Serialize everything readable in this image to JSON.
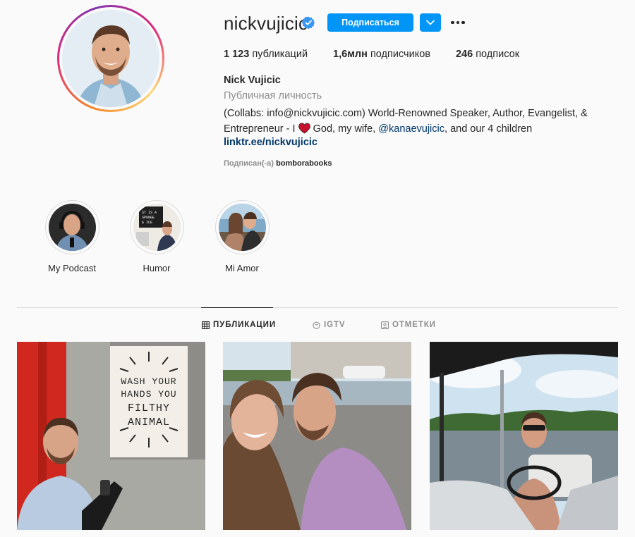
{
  "profile": {
    "username": "nickvujicic",
    "follow_label": "Подписаться",
    "stats": {
      "posts_count": "1 123",
      "posts_label": "публикаций",
      "followers_count": "1,6млн",
      "followers_label": "подписчиков",
      "following_count": "246",
      "following_label": "подписок"
    },
    "full_name": "Nick Vujicic",
    "category": "Публичная личность",
    "bio_line1": "(Collabs: info@nickvujicic.com) World-Renowned Speaker, Author, Evangelist, &",
    "bio_line2_start": "Entrepreneur - I",
    "bio_line2_mid": "God, my wife,",
    "bio_mention": "@kanaevujicic",
    "bio_line2_end": ", and our 4 children",
    "link": "linktr.ee/nickvujicic",
    "followed_by_prefix": "Подписан(-а)",
    "followed_by_user": "bomborabooks"
  },
  "highlights": [
    {
      "label": "My Podcast"
    },
    {
      "label": "Humor"
    },
    {
      "label": "Mi Amor"
    }
  ],
  "tabs": [
    {
      "label": "ПУБЛИКАЦИИ",
      "icon": "grid-icon",
      "active": true
    },
    {
      "label": "IGTV",
      "icon": "igtv-icon",
      "active": false
    },
    {
      "label": "ОТМЕТКИ",
      "icon": "tagged-icon",
      "active": false
    }
  ],
  "posts": [
    {
      "sign_lines": [
        "WASH YOUR",
        "HANDS YOU",
        "FILTHY",
        "ANIMAL"
      ]
    },
    {},
    {}
  ],
  "highlight_sign_lines": [
    "ST IS A",
    "SPONGE",
    "& ICE"
  ],
  "colors": {
    "accent": "#0095f6",
    "link": "#00376b",
    "muted": "#8e8e8e",
    "text": "#262626"
  }
}
